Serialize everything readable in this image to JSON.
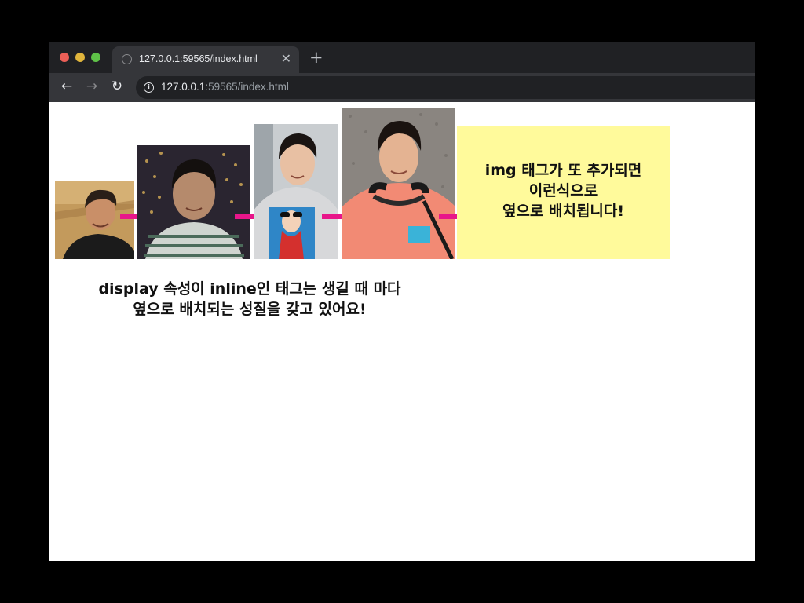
{
  "browser": {
    "tab_title": "127.0.0.1:59565/index.html",
    "close_glyph": "✕",
    "new_tab_glyph": "+",
    "back_glyph": "←",
    "forward_glyph": "→",
    "reload_glyph": "↻",
    "info_glyph": "i",
    "url_host": "127.0.0.1",
    "url_rest": ":59565/index.html"
  },
  "page": {
    "note_lines": [
      "img 태그가 또 추가되면",
      "이런식으로",
      "옆으로 배치됩니다!"
    ],
    "caption_lines": [
      "display 속성이 inline인 태그는 생길 때 마다",
      "옆으로 배치되는 성질을 갖고 있어요!"
    ],
    "photos": [
      {
        "name": "photo-1",
        "icon": "portrait-photo"
      },
      {
        "name": "photo-2",
        "icon": "portrait-photo"
      },
      {
        "name": "photo-3",
        "icon": "portrait-photo"
      },
      {
        "name": "photo-4",
        "icon": "portrait-photo"
      }
    ],
    "arrow_color": "#e8168a",
    "note_color": "#fffa9b"
  }
}
